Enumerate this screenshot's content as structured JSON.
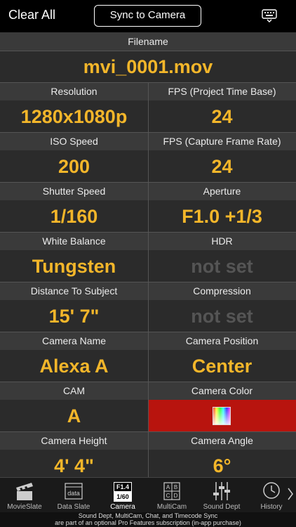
{
  "topbar": {
    "clear_all": "Clear All",
    "sync": "Sync to Camera",
    "keyboard_icon": "keyboard-dismiss-icon"
  },
  "filename": {
    "label": "Filename",
    "value": "mvi_0001.mov"
  },
  "fields": {
    "resolution": {
      "label": "Resolution",
      "value": "1280x1080p"
    },
    "fps_project": {
      "label": "FPS (Project Time Base)",
      "value": "24"
    },
    "iso": {
      "label": "ISO Speed",
      "value": "200"
    },
    "fps_capture": {
      "label": "FPS (Capture Frame Rate)",
      "value": "24"
    },
    "shutter": {
      "label": "Shutter Speed",
      "value": "1/160"
    },
    "aperture": {
      "label": "Aperture",
      "value": "F1.0 +1/3"
    },
    "white_balance": {
      "label": "White Balance",
      "value": "Tungsten"
    },
    "hdr": {
      "label": "HDR",
      "value": "not set"
    },
    "distance": {
      "label": "Distance To Subject",
      "value": "15' 7\""
    },
    "compression": {
      "label": "Compression",
      "value": "not set"
    },
    "camera_name": {
      "label": "Camera Name",
      "value": "Alexa A"
    },
    "camera_position": {
      "label": "Camera Position",
      "value": "Center"
    },
    "cam": {
      "label": "CAM",
      "value": "A"
    },
    "camera_color": {
      "label": "Camera Color",
      "value_color": "#b8140e"
    },
    "camera_height": {
      "label": "Camera Height",
      "value": "4' 4\""
    },
    "camera_angle": {
      "label": "Camera Angle",
      "value": "6°"
    }
  },
  "tabs": [
    {
      "label": "MovieSlate",
      "icon": "clapperboard-icon"
    },
    {
      "label": "Data Slate",
      "icon": "data-slate-icon",
      "icon_text": "data"
    },
    {
      "label": "Camera",
      "icon": "camera-settings-icon",
      "icon_text_top": "F1.4",
      "icon_text_bottom": "1/60",
      "active": true
    },
    {
      "label": "MultiCam",
      "icon": "multicam-grid-icon",
      "icon_letters": [
        "A",
        "B",
        "C",
        "D"
      ]
    },
    {
      "label": "Sound Dept",
      "icon": "mixer-sliders-icon"
    },
    {
      "label": "History",
      "icon": "history-clock-icon"
    }
  ],
  "footer": {
    "line1": "Sound Dept, MultiCam, Chat, and Timecode Sync",
    "line2": "are part of an optional Pro Features subscription (in-app purchase)"
  }
}
